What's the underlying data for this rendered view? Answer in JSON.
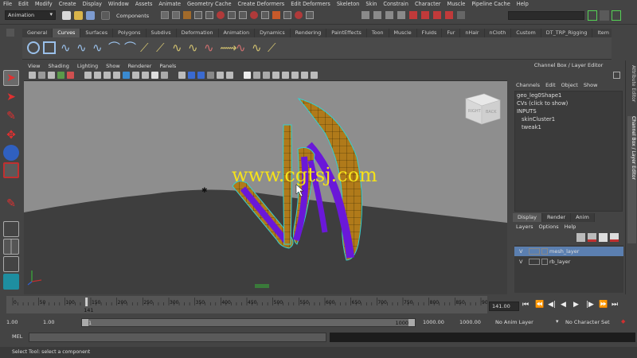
{
  "menubar": [
    "File",
    "Edit",
    "Modify",
    "Create",
    "Display",
    "Window",
    "Assets",
    "Animate",
    "Geometry Cache",
    "Create Deformers",
    "Edit Deformers",
    "Skeleton",
    "Skin",
    "Constrain",
    "Character",
    "Muscle",
    "Pipeline Cache",
    "Help"
  ],
  "toolbar": {
    "mode": "Animation",
    "components_label": "Components"
  },
  "shelf_tabs": [
    {
      "label": "General",
      "active": false
    },
    {
      "label": "Curves",
      "active": true
    },
    {
      "label": "Surfaces",
      "active": false
    },
    {
      "label": "Polygons",
      "active": false
    },
    {
      "label": "Subdivs",
      "active": false
    },
    {
      "label": "Deformation",
      "active": false
    },
    {
      "label": "Animation",
      "active": false
    },
    {
      "label": "Dynamics",
      "active": false
    },
    {
      "label": "Rendering",
      "active": false
    },
    {
      "label": "PaintEffects",
      "active": false
    },
    {
      "label": "Toon",
      "active": false
    },
    {
      "label": "Muscle",
      "active": false
    },
    {
      "label": "Fluids",
      "active": false
    },
    {
      "label": "Fur",
      "active": false
    },
    {
      "label": "nHair",
      "active": false
    },
    {
      "label": "nCloth",
      "active": false
    },
    {
      "label": "Custom",
      "active": false
    },
    {
      "label": "DT_TRP_Rigging",
      "active": false
    },
    {
      "label": "Item",
      "active": false
    }
  ],
  "viewport_menu": [
    "View",
    "Shading",
    "Lighting",
    "Show",
    "Renderer",
    "Panels"
  ],
  "viewcube": {
    "right": "RIGHT",
    "back": "BACK"
  },
  "watermark": "www.cgtsj.com",
  "channel_box": {
    "title": "Channel Box / Layer Editor",
    "menu": [
      "Channels",
      "Edit",
      "Object",
      "Show"
    ],
    "lines": [
      {
        "text": "geo_leg0Shape1",
        "indent": false
      },
      {
        "text": "CVs (click to show)",
        "indent": false
      },
      {
        "text": "INPUTS",
        "indent": false
      },
      {
        "text": "skinCluster1",
        "indent": true
      },
      {
        "text": "tweak1",
        "indent": true
      }
    ]
  },
  "layer_editor": {
    "tabs": [
      {
        "label": "Display",
        "active": true
      },
      {
        "label": "Render",
        "active": false
      },
      {
        "label": "Anim",
        "active": false
      }
    ],
    "menu": [
      "Layers",
      "Options",
      "Help"
    ],
    "layers": [
      {
        "v": "V",
        "name": "mesh_layer",
        "selected": true
      },
      {
        "v": "V",
        "name": "rb_layer",
        "selected": false
      }
    ]
  },
  "right_strip": {
    "attr": "Attribute Editor",
    "channel": "Channel Box / Layer Editor"
  },
  "timeline": {
    "ticks": [
      "0",
      "50",
      "100",
      "150",
      "200",
      "250",
      "300",
      "350",
      "400",
      "450",
      "500",
      "550",
      "600",
      "650",
      "700",
      "750",
      "800",
      "850",
      "900"
    ],
    "current_frame": "141",
    "frame_field": "141.00",
    "max_frame": 900
  },
  "range": {
    "start": "1.00",
    "start2": "1.00",
    "slider_start": "1",
    "slider_end": "1000",
    "end": "1000.00",
    "end2": "1000.00",
    "anim_layer": "No Anim Layer",
    "character_set": "No Character Set"
  },
  "mel": {
    "label": "MEL"
  },
  "status": "Select Tool: select a component",
  "colors": {
    "accent_blue": "#5b7fb0",
    "mesh_orange": "#b07a1a",
    "mesh_purple": "#6a18d8",
    "wire_cyan": "#33d0d0",
    "watermark": "#f4e21a",
    "play_red": "#c03030"
  }
}
